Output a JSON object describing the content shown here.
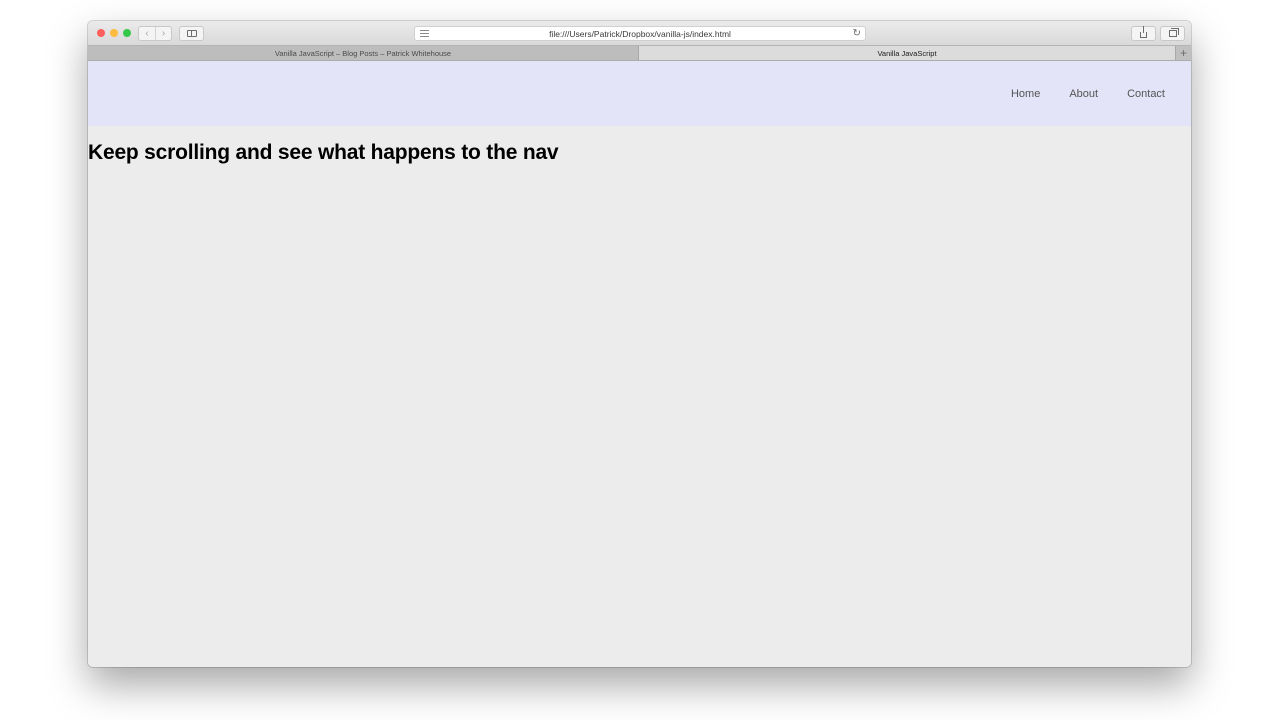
{
  "browser": {
    "url": "file:///Users/Patrick/Dropbox/vanilla-js/index.html",
    "back_icon": "chevron-left-icon",
    "forward_icon": "chevron-right-icon",
    "reload_icon": "reload-icon",
    "tabs": [
      {
        "title": "Vanilla JavaScript – Blog Posts – Patrick Whitehouse",
        "active": false
      },
      {
        "title": "Vanilla JavaScript",
        "active": true
      }
    ],
    "new_tab_label": "+"
  },
  "page": {
    "nav": {
      "background": "#e4e4f8",
      "links": [
        "Home",
        "About",
        "Contact"
      ]
    },
    "heading": "Keep scrolling and see what happens to the nav"
  }
}
